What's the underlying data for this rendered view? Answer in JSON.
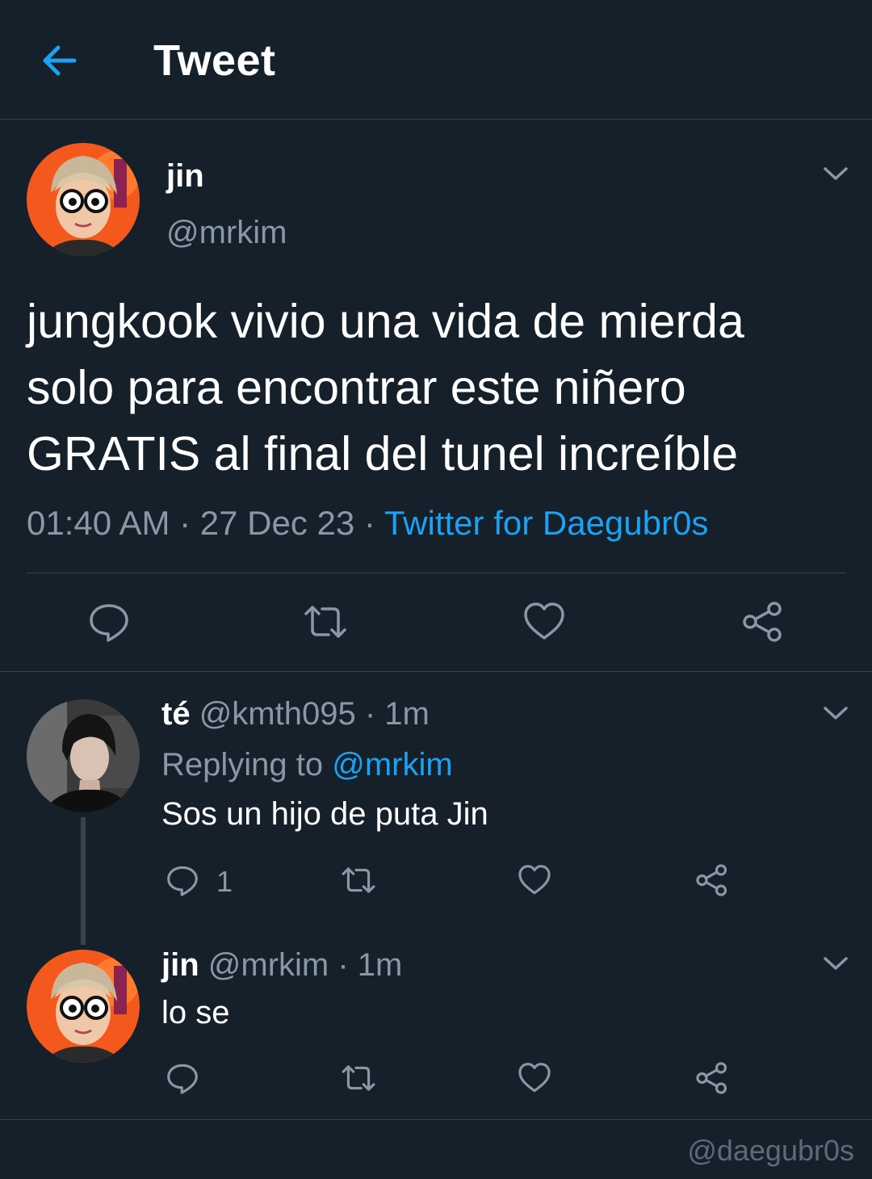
{
  "header": {
    "title": "Tweet",
    "back_icon": "arrow-left-icon",
    "accent_color": "#1da1f2"
  },
  "main_tweet": {
    "name": "jin",
    "handle": "@mrkim",
    "text": "jungkook vivio una vida de mierda\nsolo para encontrar este niñero\nGRATIS al final del tunel increíble",
    "time": "01:40 AM",
    "date": "27 Dec 23",
    "separator": " · ",
    "source": "Twitter for Daegubr0s",
    "actions": [
      "reply-icon",
      "retweet-icon",
      "like-icon",
      "share-icon"
    ]
  },
  "replies": [
    {
      "name": "té",
      "handle": "@kmth095",
      "separator": " · ",
      "time": "1m",
      "replying_label": "Replying to ",
      "replying_to": "@mrkim",
      "text": "Sos un hijo de puta Jin",
      "reply_count": "1"
    },
    {
      "name": "jin",
      "handle": "@mrkim",
      "separator": " · ",
      "time": "1m",
      "text": "lo se"
    }
  ],
  "watermark": "@daegubr0s",
  "colors": {
    "background": "#15202b",
    "secondary_text": "#8899a6",
    "divider": "#38444d",
    "link": "#1da1f2"
  }
}
